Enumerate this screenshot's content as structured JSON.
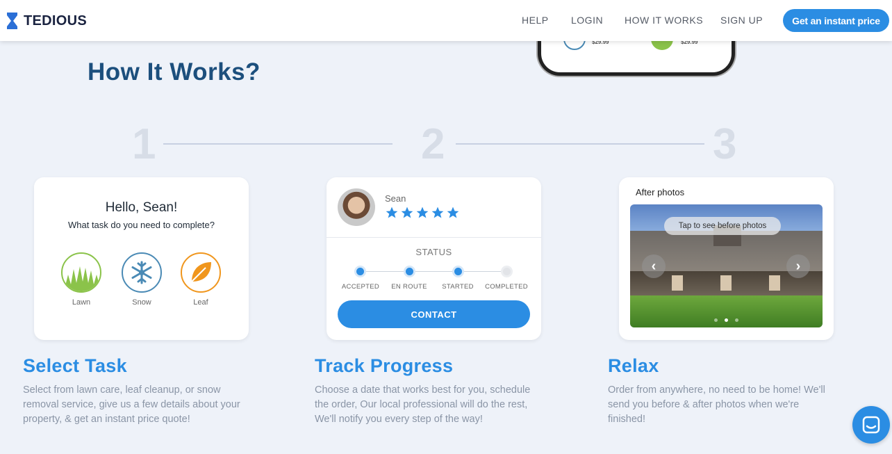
{
  "header": {
    "brand": "TEDIOUS",
    "nav": [
      {
        "id": "help",
        "label": "HELP"
      },
      {
        "id": "login",
        "label": "LOGIN"
      },
      {
        "id": "how",
        "label": "HOW IT WORKS"
      },
      {
        "id": "signup",
        "label": "SIGN UP"
      }
    ],
    "cta_label": "Get an instant price"
  },
  "phone": {
    "price1": "$29.99",
    "price2": "$29.99"
  },
  "page_title": "How It Works?",
  "steps": [
    "1",
    "2",
    "3"
  ],
  "card1": {
    "greeting": "Hello, Sean!",
    "question": "What task do you need to complete?",
    "services": [
      {
        "label": "Lawn",
        "icon": "grass-icon",
        "color": "#8bc34a"
      },
      {
        "label": "Snow",
        "icon": "snowflake-icon",
        "color": "#4a8ab5"
      },
      {
        "label": "Leaf",
        "icon": "leaf-icon",
        "color": "#f0961d"
      }
    ]
  },
  "card2": {
    "name": "Sean",
    "rating": 5,
    "status_label": "STATUS",
    "stages": [
      {
        "label": "ACCEPTED",
        "done": true
      },
      {
        "label": "EN ROUTE",
        "done": true
      },
      {
        "label": "STARTED",
        "done": true
      },
      {
        "label": "COMPLETED",
        "done": false
      }
    ],
    "contact_label": "CONTACT"
  },
  "card3": {
    "title": "After photos",
    "tooltip": "Tap to see before photos",
    "prev_glyph": "‹",
    "next_glyph": "›"
  },
  "sections": [
    {
      "title": "Select Task",
      "desc": "Select from lawn care, leaf cleanup, or snow removal service, give us a few details about your property, & get an instant price quote!"
    },
    {
      "title": "Track Progress",
      "desc": "Choose a date that works best for you, schedule the order, Our local professional will do the rest, We'll notify you every step of the way!"
    },
    {
      "title": "Relax",
      "desc": "Order from anywhere, no need to be home! We'll send you before & after photos when we're finished!"
    }
  ],
  "colors": {
    "accent": "#2b8de3",
    "title": "#1c4f7d"
  }
}
